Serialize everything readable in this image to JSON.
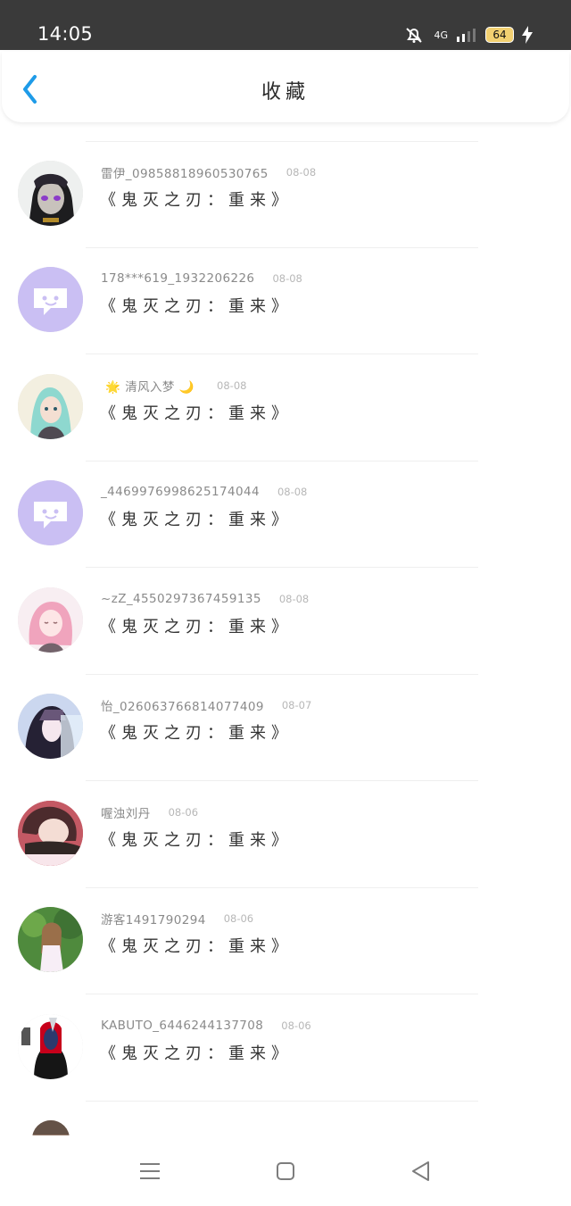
{
  "status": {
    "time": "14:05",
    "network": "4G",
    "battery": "64"
  },
  "header": {
    "title": "收藏",
    "back_icon": "back-chevron"
  },
  "list": [
    {
      "user": "雷伊_09858818960530765",
      "date": "08-08",
      "title": "《鬼灭之刃：重来》"
    },
    {
      "user": "178***619_1932206226",
      "date": "08-08",
      "title": "《鬼灭之刃：重来》"
    },
    {
      "user_prefix": "🌟",
      "user": "清风入梦",
      "user_suffix": "🌙",
      "date": "08-08",
      "title": "《鬼灭之刃：重来》"
    },
    {
      "user": "_4469976998625174044",
      "date": "08-08",
      "title": "《鬼灭之刃：重来》"
    },
    {
      "user": "~zZ_4550297367459135",
      "date": "08-08",
      "title": "《鬼灭之刃：重来》"
    },
    {
      "user": "怡_02606376681407740​9",
      "date": "08-07",
      "title": "《鬼灭之刃：重来》"
    },
    {
      "user": "喔浊刘丹",
      "date": "08-06",
      "title": "《鬼灭之刃：重来》"
    },
    {
      "user": "游客1491790294",
      "date": "08-06",
      "title": "《鬼灭之刃：重来》"
    },
    {
      "user": "KABUTO_6446244137708",
      "date": "08-06",
      "title": "《鬼灭之刃：重来》"
    }
  ],
  "colors": {
    "accent": "#1e9be8",
    "status_bg": "#3a3a3a",
    "placeholder_avatar": "#cabff3"
  }
}
